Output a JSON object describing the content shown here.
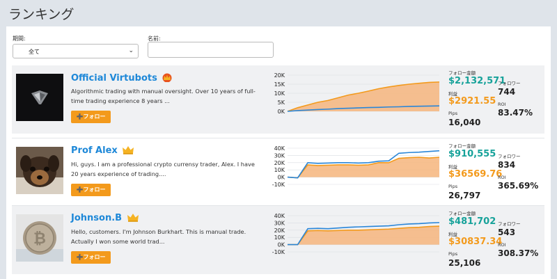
{
  "page": {
    "title": "ランキング"
  },
  "filters": {
    "period_label": "期間:",
    "period_value": "全て",
    "name_label": "名前:",
    "name_value": ""
  },
  "rows": [
    {
      "name": "Official Virtubots",
      "badge": "crown-orange",
      "description": "Algorithmic trading with manual oversight. Over 10 years of full-time trading experience 8 years ...",
      "follow_label": "フォロー",
      "follow_amount_label": "フォロー金額",
      "follow_amount": "$2,132,571",
      "profit_label": "利益",
      "profit": "$2921.55",
      "pips_label": "Pips",
      "pips": "16,040",
      "followers_label": "フォロワー",
      "followers": "744",
      "roi_label": "ROI",
      "roi": "83.47%",
      "chart_data": {
        "type": "area",
        "y_ticks": [
          "20K",
          "15K",
          "10K",
          "5K",
          "0K"
        ],
        "ylim": [
          0,
          20000
        ],
        "series": [
          {
            "color": "#f39a1c",
            "values": [
              0,
              2000,
              3500,
              5000,
              6000,
              7500,
              9000,
              10000,
              11200,
              12500,
              13500,
              14300,
              15000,
              15500,
              16000,
              16200
            ]
          },
          {
            "color": "#2a86d8",
            "values": [
              0,
              400,
              700,
              1000,
              1200,
              1500,
              1700,
              1900,
              2100,
              2200,
              2400,
              2500,
              2700,
              2800,
              2900,
              3000
            ]
          }
        ]
      }
    },
    {
      "name": "Prof Alex",
      "badge": "crown-gold",
      "description": "Hi, guys. I am a professional crypto currensy trader, Alex. I have 20 years experience of trading....",
      "follow_label": "フォロー",
      "follow_amount_label": "フォロー金額",
      "follow_amount": "$910,555",
      "profit_label": "利益",
      "profit": "$36569.76",
      "pips_label": "Pips",
      "pips": "26,797",
      "followers_label": "フォロワー",
      "followers": "834",
      "roi_label": "ROI",
      "roi": "365.69%",
      "chart_data": {
        "type": "area",
        "y_ticks": [
          "40K",
          "30K",
          "20K",
          "10K",
          "0K",
          "-10K"
        ],
        "ylim": [
          -10000,
          40000
        ],
        "series": [
          {
            "color": "#f39a1c",
            "values": [
              0,
              -1000,
              17000,
              16000,
              16500,
              17000,
              17000,
              16500,
              17000,
              20000,
              20000,
              26000,
              27000,
              27500,
              26500,
              27500
            ]
          },
          {
            "color": "#2a86d8",
            "values": [
              0,
              -1000,
              20000,
              19000,
              19500,
              20000,
              20000,
              19500,
              20000,
              22000,
              22500,
              33000,
              34000,
              34500,
              35500,
              36500
            ]
          }
        ]
      }
    },
    {
      "name": "Johnson.B",
      "badge": "crown-gold",
      "description": "Hello, customers. I'm Johnson Burkhart. This is manual trade. Actually I won some world trad...",
      "follow_label": "フォロー",
      "follow_amount_label": "フォロー金額",
      "follow_amount": "$481,702",
      "profit_label": "利益",
      "profit": "$30837.34",
      "pips_label": "Pips",
      "pips": "25,106",
      "followers_label": "フォロワー",
      "followers": "543",
      "roi_label": "ROI",
      "roi": "308.37%",
      "chart_data": {
        "type": "area",
        "y_ticks": [
          "40K",
          "30K",
          "20K",
          "10K",
          "0K",
          "-10K"
        ],
        "ylim": [
          -10000,
          40000
        ],
        "series": [
          {
            "color": "#f39a1c",
            "values": [
              0,
              0,
              19000,
              19500,
              19000,
              19500,
              20000,
              20000,
              20500,
              21000,
              21500,
              22500,
              23500,
              24000,
              25000,
              25500
            ]
          },
          {
            "color": "#2a86d8",
            "values": [
              0,
              0,
              22000,
              22500,
              22000,
              23000,
              24000,
              24500,
              25000,
              25500,
              26000,
              27500,
              28500,
              29000,
              30000,
              30500
            ]
          }
        ]
      }
    }
  ]
}
